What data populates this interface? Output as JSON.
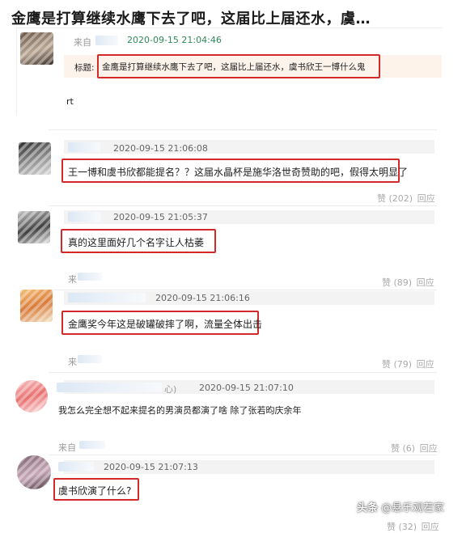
{
  "page_title": "金鹰是打算继续水鹰下去了吧，这届比上届还水，虞…",
  "post": {
    "from_label": "来自",
    "timestamp": "2020-09-15 21:04:46",
    "subject_label": "标题:",
    "subject_text": "金鹰是打算继续水鹰下去了吧，这届比上届还水，虞书欣王一博什么鬼",
    "body": "rt"
  },
  "comments": [
    {
      "timestamp": "2020-09-15 21:06:08",
      "text": "王一博和虞书欣都能提名？？这届水晶杯是施华洛世奇赞助的吧，假得太明显了",
      "like_label": "赞",
      "like_count": "(202)",
      "reply_label": "回应"
    },
    {
      "timestamp": "2020-09-15 21:05:37",
      "text": "真的这里面好几个名字让人枯萎",
      "from_label": "来",
      "like_label": "赞",
      "like_count": "(89)",
      "reply_label": "回应"
    },
    {
      "timestamp": "2020-09-15 21:06:16",
      "text": "金鹰奖今年这是破罐破摔了啊，流量全体出击",
      "from_label": "来",
      "like_label": "赞",
      "like_count": "(79)",
      "reply_label": "回应"
    },
    {
      "name_suffix": "心)",
      "timestamp": "2020-09-15 21:07:10",
      "text": "我怎么完全想不起来提名的男演员都演了啥 除了张若昀庆余年",
      "from_label": "来自",
      "like_label": "赞",
      "like_count": "(6)",
      "reply_label": "回应"
    },
    {
      "timestamp": "2020-09-15 21:07:13",
      "text": "虞书欣演了什么?",
      "like_label": "赞",
      "like_count": "(32)",
      "reply_label": "回应"
    }
  ],
  "watermark": {
    "platform": "头条",
    "handle": "@悬乐观茬家"
  },
  "colors": {
    "highlight_border": "#d22a2a",
    "timestamp_green": "#2e8b57",
    "subject_bg": "#fdf3ea"
  }
}
